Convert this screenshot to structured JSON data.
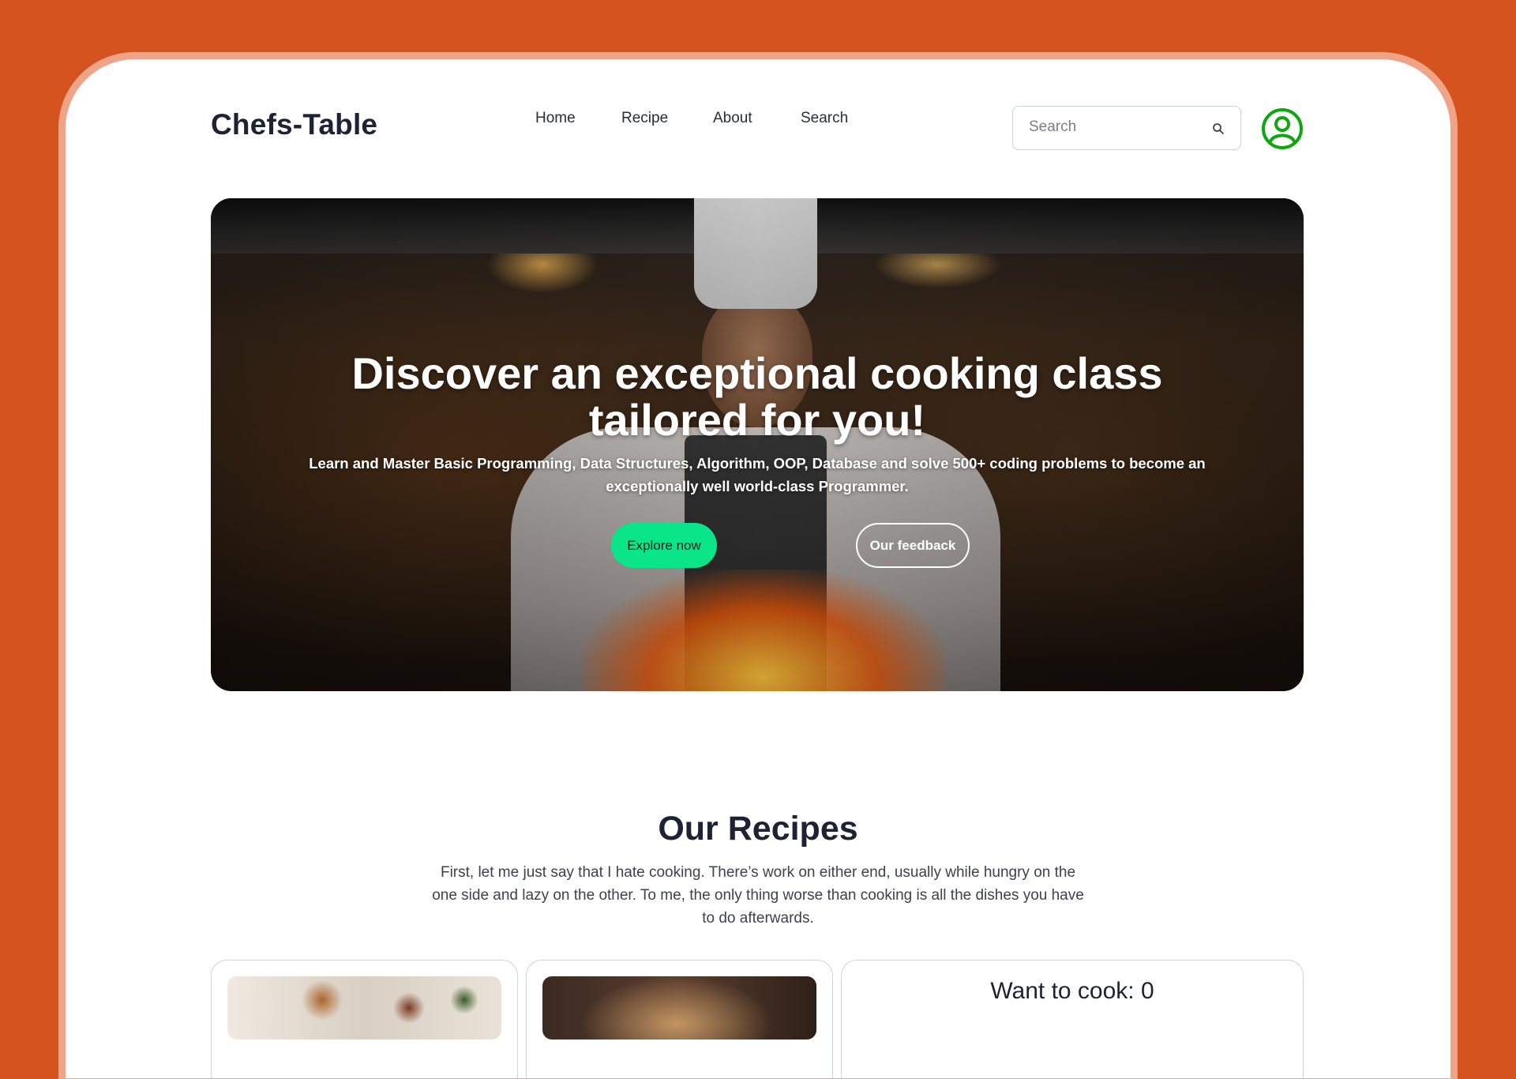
{
  "brand": {
    "name": "Chefs-Table"
  },
  "nav": {
    "items": [
      {
        "label": "Home"
      },
      {
        "label": "Recipe"
      },
      {
        "label": "About"
      },
      {
        "label": "Search"
      }
    ]
  },
  "search": {
    "placeholder": "Search",
    "value": ""
  },
  "icons": {
    "search": "search-icon",
    "profile": "user-circle-icon",
    "profile_color": "#0EA70E"
  },
  "hero": {
    "title_line1": "Discover an exceptional cooking class",
    "title_line2": "tailored for you!",
    "subtitle": "Learn and Master Basic Programming, Data Structures, Algorithm, OOP, Database and solve 500+ coding problems to become an exceptionally well world-class Programmer.",
    "primary_button": "Explore now",
    "secondary_button": "Our feedback"
  },
  "recipes": {
    "title": "Our Recipes",
    "description": "First, let me just say that I hate cooking. There’s work on either end, usually while hungry on the one side and lazy on the other. To me, the only thing worse than cooking is all the dishes you have to do afterwards.",
    "want_to_cook_label": "Want to cook: 0"
  },
  "colors": {
    "background": "#D4531E",
    "accent_green": "#0BE58A",
    "text_dark": "#1E2235"
  }
}
